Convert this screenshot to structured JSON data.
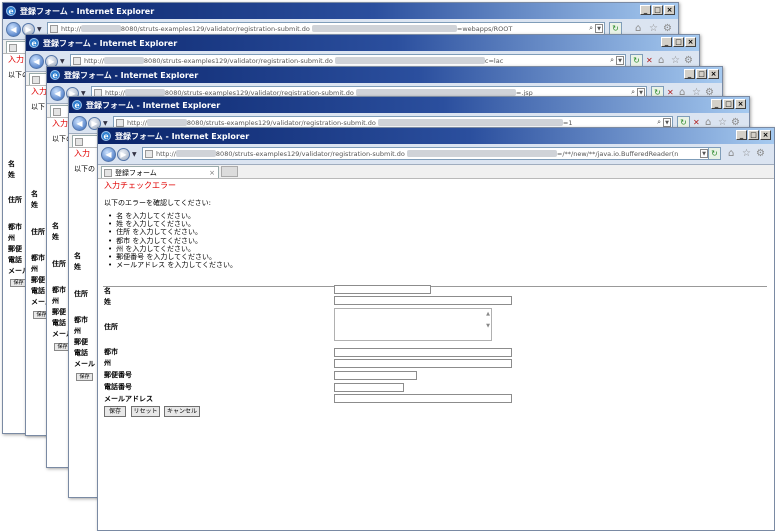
{
  "window": {
    "title": "登録フォーム - Internet Explorer",
    "url_prefix": "http://",
    "url_path": "8080/struts-examples129/validator/registration-submit.do"
  },
  "background_windows": [
    {
      "url_suffix": "=webapps/ROOT",
      "peek": [
        "入力",
        "以下の",
        "名",
        "姓",
        "住所",
        "都市",
        "州",
        "郵便",
        "電話",
        "メール",
        "保存"
      ]
    },
    {
      "url_suffix": "c=lac",
      "peek": [
        "入力",
        "以下",
        "名",
        "姓",
        "住所",
        "都市",
        "州",
        "郵便",
        "電話",
        "メール",
        "保存"
      ]
    },
    {
      "url_suffix": "=.jsp",
      "peek": [
        "入力",
        "以下の",
        "名",
        "姓",
        "住所",
        "都市",
        "州",
        "郵便",
        "電話",
        "メール",
        "保存"
      ]
    },
    {
      "url_suffix": "=1",
      "peek": [
        "入力",
        "以下の",
        "名",
        "姓",
        "住所",
        "都市",
        "州",
        "郵便",
        "電話",
        "メール",
        "保存"
      ]
    }
  ],
  "front_window": {
    "url_suffix": "=/**/new/**/java.io.BufferedReader(n",
    "tab_label": "登録フォーム",
    "heading": "入力チェックエラー",
    "intro": "以下のエラーを確認してください:",
    "errors": [
      "名 を入力してください。",
      "姓 を入力してください。",
      "住所 を入力してください。",
      "都市 を入力してください。",
      "州 を入力してください。",
      "郵便番号 を入力してください。",
      "メールアドレス を入力してください。"
    ],
    "labels": {
      "first_name": "名",
      "last_name": "姓",
      "address": "住所",
      "city": "都市",
      "state": "州",
      "zip": "郵便番号",
      "phone": "電話番号",
      "email": "メールアドレス"
    },
    "buttons": {
      "save": "保存",
      "reset": "リセット",
      "cancel": "キャンセル"
    }
  }
}
